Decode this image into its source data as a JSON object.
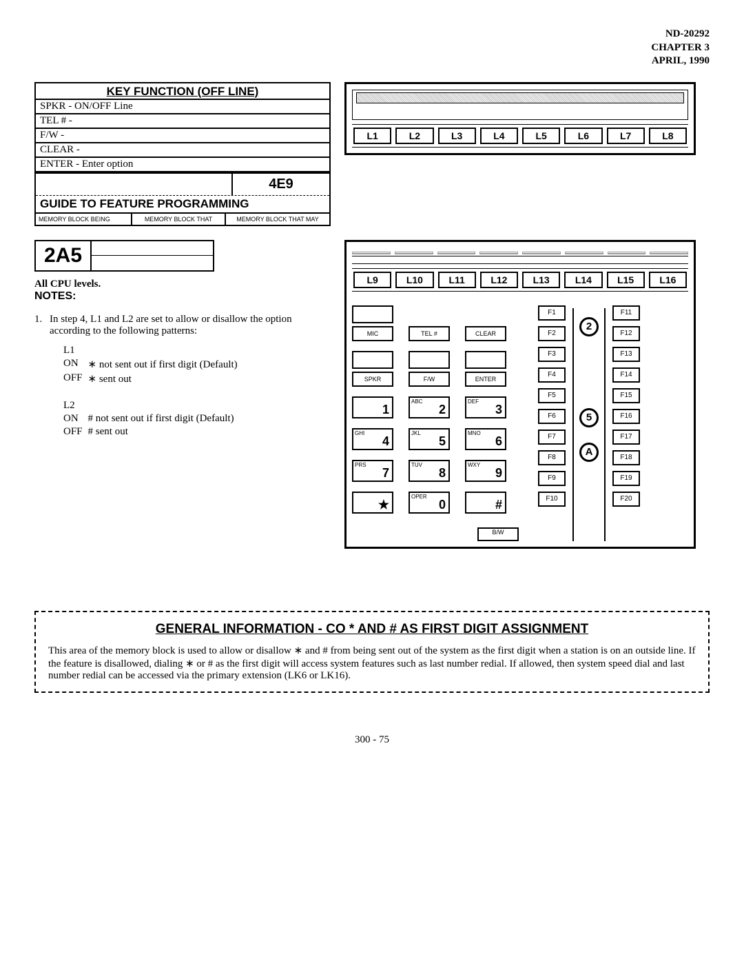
{
  "header": {
    "doc": "ND-20292",
    "chapter": "CHAPTER 3",
    "date": "APRIL, 1990"
  },
  "keyfunc": {
    "title": "KEY FUNCTION (OFF LINE)",
    "lines": [
      "SPKR - ON/OFF Line",
      "TEL # -",
      "F/W -",
      "CLEAR -",
      "ENTER - Enter option"
    ],
    "code": "4E9",
    "guide": "GUIDE TO FEATURE PROGRAMMING",
    "mem1": "MEMORY BLOCK BEING",
    "mem2": "MEMORY BLOCK THAT",
    "mem3": "MEMORY BLOCK THAT MAY"
  },
  "lbuttons1": [
    "L1",
    "L2",
    "L3",
    "L4",
    "L5",
    "L6",
    "L7",
    "L8"
  ],
  "lbuttons2": [
    "L9",
    "L10",
    "L11",
    "L12",
    "L13",
    "L14",
    "L15",
    "L16"
  ],
  "sec_code": "2A5",
  "cpu": "All CPU levels.",
  "notes_h": "NOTES:",
  "note1": {
    "num": "1.",
    "text1": "In step 4, L1 and L2 are set to allow or disallow the option according to the following patterns:",
    "l1h": "L1",
    "l1on_lbl": "ON",
    "l1on_desc": "∗ not sent out if first digit (Default)",
    "l1off_lbl": "OFF",
    "l1off_desc": "∗ sent out",
    "l2h": "L2",
    "l2on_lbl": "ON",
    "l2on_desc": "# not sent out if first digit (Default)",
    "l2off_lbl": "OFF",
    "l2off_desc": "# sent out"
  },
  "keypad": {
    "row1": [
      "MIC",
      "TEL #",
      "CLEAR"
    ],
    "row2": [
      "SPKR",
      "F/W",
      "ENTER"
    ],
    "dial": [
      {
        "sub": "",
        "num": "1"
      },
      {
        "sub": "ABC",
        "num": "2"
      },
      {
        "sub": "DEF",
        "num": "3"
      },
      {
        "sub": "GHI",
        "num": "4"
      },
      {
        "sub": "JKL",
        "num": "5"
      },
      {
        "sub": "MNO",
        "num": "6"
      },
      {
        "sub": "PRS",
        "num": "7"
      },
      {
        "sub": "TUV",
        "num": "8"
      },
      {
        "sub": "WXY",
        "num": "9"
      },
      {
        "sub": "",
        "num": "★"
      },
      {
        "sub": "OPER",
        "num": "0"
      },
      {
        "sub": "",
        "num": "#"
      }
    ],
    "bw": "B/W",
    "fcol_left": [
      "F1",
      "F2",
      "F3",
      "F4",
      "F5",
      "F6",
      "F7",
      "F8",
      "F9",
      "F10"
    ],
    "circles": [
      "2",
      "5",
      "A"
    ],
    "fcol_right": [
      "F11",
      "F12",
      "F13",
      "F14",
      "F15",
      "F16",
      "F17",
      "F18",
      "F19",
      "F20"
    ]
  },
  "gen": {
    "title": "GENERAL INFORMATION  -  CO * AND # AS FIRST DIGIT ASSIGNMENT",
    "body": "This area of the memory block is used to allow or disallow ∗ and # from being sent out of the system as the first digit when a station is on an outside line. If the feature is disallowed, dialing ∗ or # as the first digit will access system features such as last number redial. If allowed, then system speed dial and last number redial can be accessed via the primary extension (LK6 or LK16)."
  },
  "page": "300 - 75"
}
